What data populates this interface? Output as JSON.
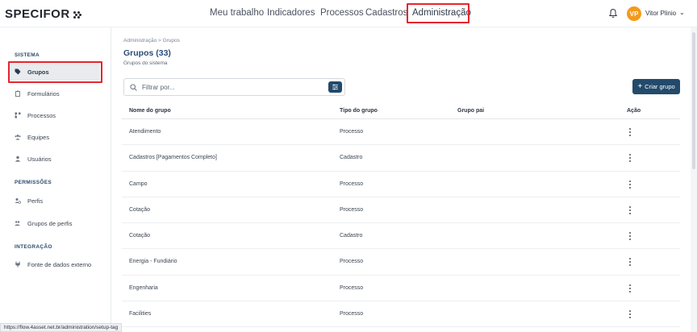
{
  "header": {
    "logo": "SPECIFOR",
    "nav": [
      {
        "label": "Meu trabalho"
      },
      {
        "label": "Indicadores"
      },
      {
        "label": "Processos"
      },
      {
        "label": "Cadastros"
      },
      {
        "label": "Administração"
      }
    ],
    "active_nav": "Administração",
    "user": {
      "initials": "VP",
      "name": "Vitor Plinio",
      "chevron": "chevron-down-icon"
    },
    "icons": [
      "bell-icon"
    ]
  },
  "sidebar": {
    "sections": [
      {
        "title": "SISTEMA",
        "items": [
          {
            "label": "Grupos",
            "icon": "tag-icon",
            "selected": true
          },
          {
            "label": "Formulários",
            "icon": "clipboard-icon"
          },
          {
            "label": "Processos",
            "icon": "flow-icon"
          },
          {
            "label": "Equipes",
            "icon": "team-icon"
          },
          {
            "label": "Usuários",
            "icon": "user-icon"
          }
        ]
      },
      {
        "title": "PERMISSÕES",
        "items": [
          {
            "label": "Perfis",
            "icon": "profile-icon"
          },
          {
            "label": "Grupos de perfis",
            "icon": "profile-group-icon"
          }
        ]
      },
      {
        "title": "INTEGRAÇÃO",
        "items": [
          {
            "label": "Fonte de dados externo",
            "icon": "plug-icon"
          }
        ]
      }
    ]
  },
  "main": {
    "breadcrumb": "Administração  >  Grupos",
    "title": "Grupos (33)",
    "subtitle": "Grupos do sistema",
    "search": {
      "placeholder": "Filtrar por...",
      "value": ""
    },
    "create_button": {
      "label": "Criar grupo",
      "icon": "plus-icon"
    },
    "table": {
      "columns": [
        "Nome do grupo",
        "Tipo do grupo",
        "Grupo pai",
        "Ação"
      ],
      "rows": [
        {
          "name": "Atendimento",
          "type": "Processo",
          "parent": ""
        },
        {
          "name": "Cadastros [Pagamentos Completo]",
          "type": "Cadastro",
          "parent": ""
        },
        {
          "name": "Campo",
          "type": "Processo",
          "parent": ""
        },
        {
          "name": "Cotação",
          "type": "Processo",
          "parent": ""
        },
        {
          "name": "Cotação",
          "type": "Cadastro",
          "parent": ""
        },
        {
          "name": "Energia - Fundiário",
          "type": "Processo",
          "parent": ""
        },
        {
          "name": "Engenharia",
          "type": "Processo",
          "parent": ""
        },
        {
          "name": "Facilities",
          "type": "Processo",
          "parent": ""
        }
      ]
    }
  },
  "status_bar_url": "https://flow.4asset.net.br/administration/setup-tag",
  "colors": {
    "primary": "#234a6b",
    "title": "#2b4e78",
    "highlight": "#e5252f",
    "avatar": "#f39a1c"
  }
}
